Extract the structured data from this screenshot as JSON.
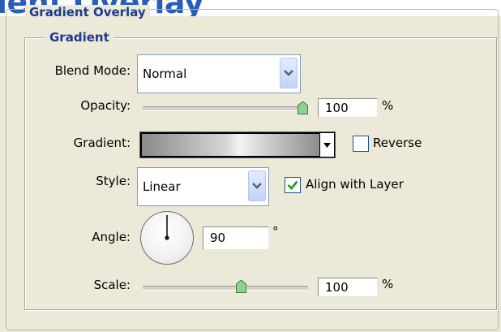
{
  "window": {
    "title_text": "ient Overlay"
  },
  "groups": {
    "outer_title": "Gradient Overlay",
    "inner_title": "Gradient"
  },
  "blend_mode": {
    "label": "Blend Mode:",
    "value": "Normal"
  },
  "opacity": {
    "label": "Opacity:",
    "value": "100",
    "unit": "%",
    "slider_fraction": 1.0
  },
  "gradient": {
    "label": "Gradient:",
    "colors": [
      "#8a8a8a",
      "#d7d7d7",
      "#f4f4f4",
      "#cfcfcf",
      "#8d8d8d"
    ]
  },
  "reverse": {
    "label": "Reverse",
    "checked": false
  },
  "style": {
    "label": "Style:",
    "value": "Linear"
  },
  "align_with_layer": {
    "label": "Align with Layer",
    "checked": true
  },
  "angle": {
    "label": "Angle:",
    "value": "90",
    "unit": "°",
    "degrees": 90
  },
  "scale": {
    "label": "Scale:",
    "value": "100",
    "unit": "%",
    "slider_fraction": 0.667
  },
  "colors": {
    "legend": "#1b3b8f",
    "title": "#2a5db8",
    "panel": "#ece9d8",
    "check": "#21a121"
  }
}
